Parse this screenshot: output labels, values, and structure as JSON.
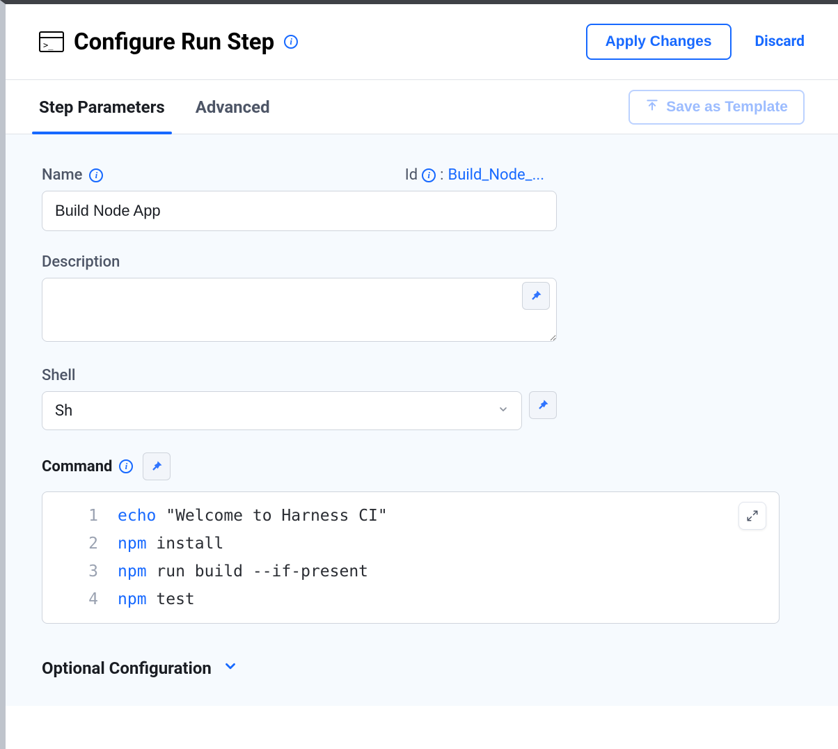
{
  "header": {
    "title": "Configure Run Step",
    "apply_label": "Apply Changes",
    "discard_label": "Discard"
  },
  "tabs": {
    "parameters": "Step Parameters",
    "advanced": "Advanced",
    "save_template": "Save as Template"
  },
  "fields": {
    "name_label": "Name",
    "name_value": "Build Node App",
    "id_label": "Id",
    "id_value": "Build_Node_...",
    "description_label": "Description",
    "description_value": "",
    "shell_label": "Shell",
    "shell_value": "Sh",
    "command_label": "Command",
    "optional_label": "Optional Configuration"
  },
  "code": {
    "l1_kw": "echo",
    "l1_rest": " \"Welcome to Harness CI\"",
    "l2_kw": "npm",
    "l2_rest": " install",
    "l3_kw": "npm",
    "l3_rest": " run build --if-present",
    "l4_kw": "npm",
    "l4_rest": " test",
    "n1": "1",
    "n2": "2",
    "n3": "3",
    "n4": "4"
  }
}
